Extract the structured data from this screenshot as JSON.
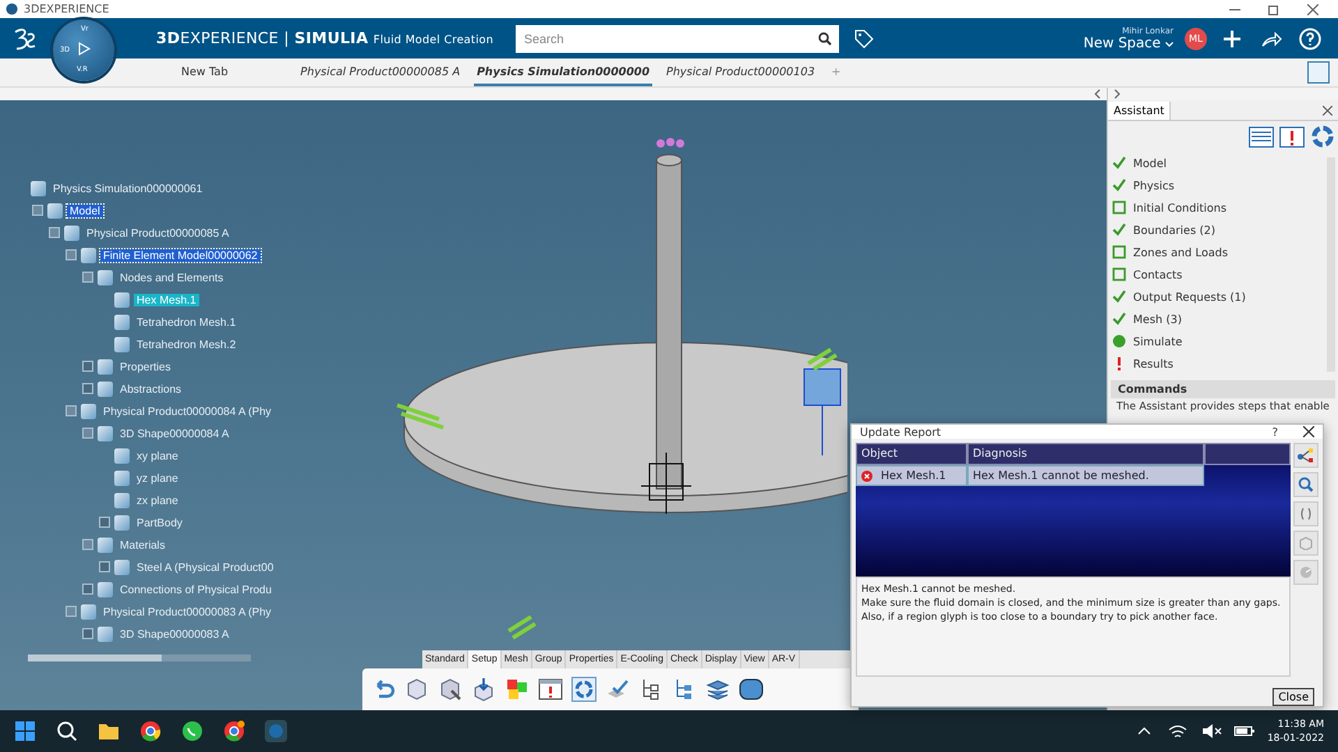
{
  "window": {
    "title": "3DEXPERIENCE"
  },
  "top_bar": {
    "brand": "3D",
    "brand_rest": "EXPERIENCE | ",
    "product": "SIMULIA",
    "app": "Fluid Model Creation",
    "compass": {
      "label_left": "3D",
      "label_bottom": "V.R",
      "label_top": "Vr"
    },
    "search": {
      "placeholder": "Search"
    },
    "user": "Mihir Lonkar",
    "space": "New Space",
    "avatar": "ML"
  },
  "doc_tabs": [
    {
      "label": "New Tab",
      "kind": "new",
      "selected": false
    },
    {
      "label": "Physical Product00000085 A",
      "kind": "document",
      "selected": false
    },
    {
      "label": "Physics Simulation0000000",
      "kind": "document",
      "selected": true
    },
    {
      "label": "Physical Product00000103",
      "kind": "document",
      "selected": false
    },
    {
      "label": "+",
      "kind": "add",
      "selected": false
    }
  ],
  "tree": {
    "items": [
      {
        "label": "Physics Simulation000000061",
        "selected": false,
        "highlighted": false,
        "children": [
          {
            "label": "Model",
            "selected": true,
            "highlighted": false,
            "expanded": true,
            "children": [
              {
                "label": "Physical Product00000085 A",
                "selected": false,
                "highlighted": false,
                "expanded": true,
                "children": [
                  {
                    "label": "Finite Element Model00000062",
                    "selected": true,
                    "highlighted": false,
                    "expanded": true,
                    "children": [
                      {
                        "label": "Nodes and Elements",
                        "selected": false,
                        "highlighted": false,
                        "expanded": true,
                        "children": [
                          {
                            "label": "Hex Mesh.1",
                            "selected": false,
                            "highlighted": true
                          },
                          {
                            "label": "Tetrahedron Mesh.1",
                            "selected": false,
                            "highlighted": false
                          },
                          {
                            "label": "Tetrahedron Mesh.2",
                            "selected": false,
                            "highlighted": false
                          }
                        ]
                      },
                      {
                        "label": "Properties",
                        "selected": false,
                        "highlighted": false,
                        "expanded": false
                      },
                      {
                        "label": "Abstractions",
                        "selected": false,
                        "highlighted": false,
                        "expanded": false
                      }
                    ]
                  },
                  {
                    "label": "Physical Product00000084 A (Phy",
                    "selected": false,
                    "highlighted": false,
                    "expanded": true,
                    "children": [
                      {
                        "label": "3D Shape00000084 A",
                        "selected": false,
                        "highlighted": false,
                        "expanded": true,
                        "children": [
                          {
                            "label": "xy plane",
                            "selected": false,
                            "highlighted": false
                          },
                          {
                            "label": "yz plane",
                            "selected": false,
                            "highlighted": false
                          },
                          {
                            "label": "zx plane",
                            "selected": false,
                            "highlighted": false
                          },
                          {
                            "label": "PartBody",
                            "selected": false,
                            "highlighted": false,
                            "expanded": false
                          }
                        ]
                      },
                      {
                        "label": "Materials",
                        "selected": false,
                        "highlighted": false,
                        "expanded": true,
                        "children": [
                          {
                            "label": "Steel A (Physical Product00",
                            "selected": false,
                            "highlighted": false,
                            "expanded": false
                          }
                        ]
                      },
                      {
                        "label": "Connections of Physical Produ",
                        "selected": false,
                        "highlighted": false,
                        "expanded": false
                      }
                    ]
                  },
                  {
                    "label": "Physical Product00000083 A (Phy",
                    "selected": false,
                    "highlighted": false,
                    "expanded": true,
                    "children": [
                      {
                        "label": "3D Shape00000083 A",
                        "selected": false,
                        "highlighted": false,
                        "expanded": false
                      }
                    ]
                  }
                ]
              }
            ]
          }
        ]
      }
    ]
  },
  "assistant": {
    "title": "Assistant",
    "steps": [
      {
        "label": "Model",
        "kind": "done"
      },
      {
        "label": "Physics",
        "kind": "done"
      },
      {
        "label": "Initial Conditions",
        "kind": "todo"
      },
      {
        "label": "Boundaries (2)",
        "kind": "done"
      },
      {
        "label": "Zones and Loads",
        "kind": "todo"
      },
      {
        "label": "Contacts",
        "kind": "todo"
      },
      {
        "label": "Output Requests (1)",
        "kind": "done"
      },
      {
        "label": "Mesh (3)",
        "kind": "done"
      },
      {
        "label": "Simulate",
        "kind": "ready"
      },
      {
        "label": "Results",
        "kind": "alert"
      }
    ],
    "commands_title": "Commands",
    "commands_text": "The Assistant provides steps that enable"
  },
  "dialog": {
    "title": "Update Report",
    "help": "?",
    "columns": [
      "Object",
      "Diagnosis"
    ],
    "rows": [
      {
        "object": "Hex Mesh.1",
        "diagnosis": "Hex Mesh.1 cannot be meshed.",
        "selected": true
      }
    ],
    "message": [
      "Hex Mesh.1 cannot be meshed.",
      "Make sure the fluid domain is closed, and the minimum size is greater than any gaps.",
      "Also, if a region glyph is too close to a boundary try to pick another face."
    ],
    "close_button": "Close"
  },
  "toolbar": {
    "sections": [
      {
        "label": "Standard",
        "selected": false
      },
      {
        "label": "Setup",
        "selected": true
      },
      {
        "label": "Mesh",
        "selected": false
      },
      {
        "label": "Group",
        "selected": false
      },
      {
        "label": "Properties",
        "selected": false
      },
      {
        "label": "E-Cooling",
        "selected": false
      },
      {
        "label": "Check",
        "selected": false
      },
      {
        "label": "Display",
        "selected": false
      },
      {
        "label": "View",
        "selected": false
      },
      {
        "label": "AR-V",
        "selected": false
      }
    ]
  },
  "taskbar": {
    "time": "11:38 AM",
    "date": "18-01-2022"
  }
}
